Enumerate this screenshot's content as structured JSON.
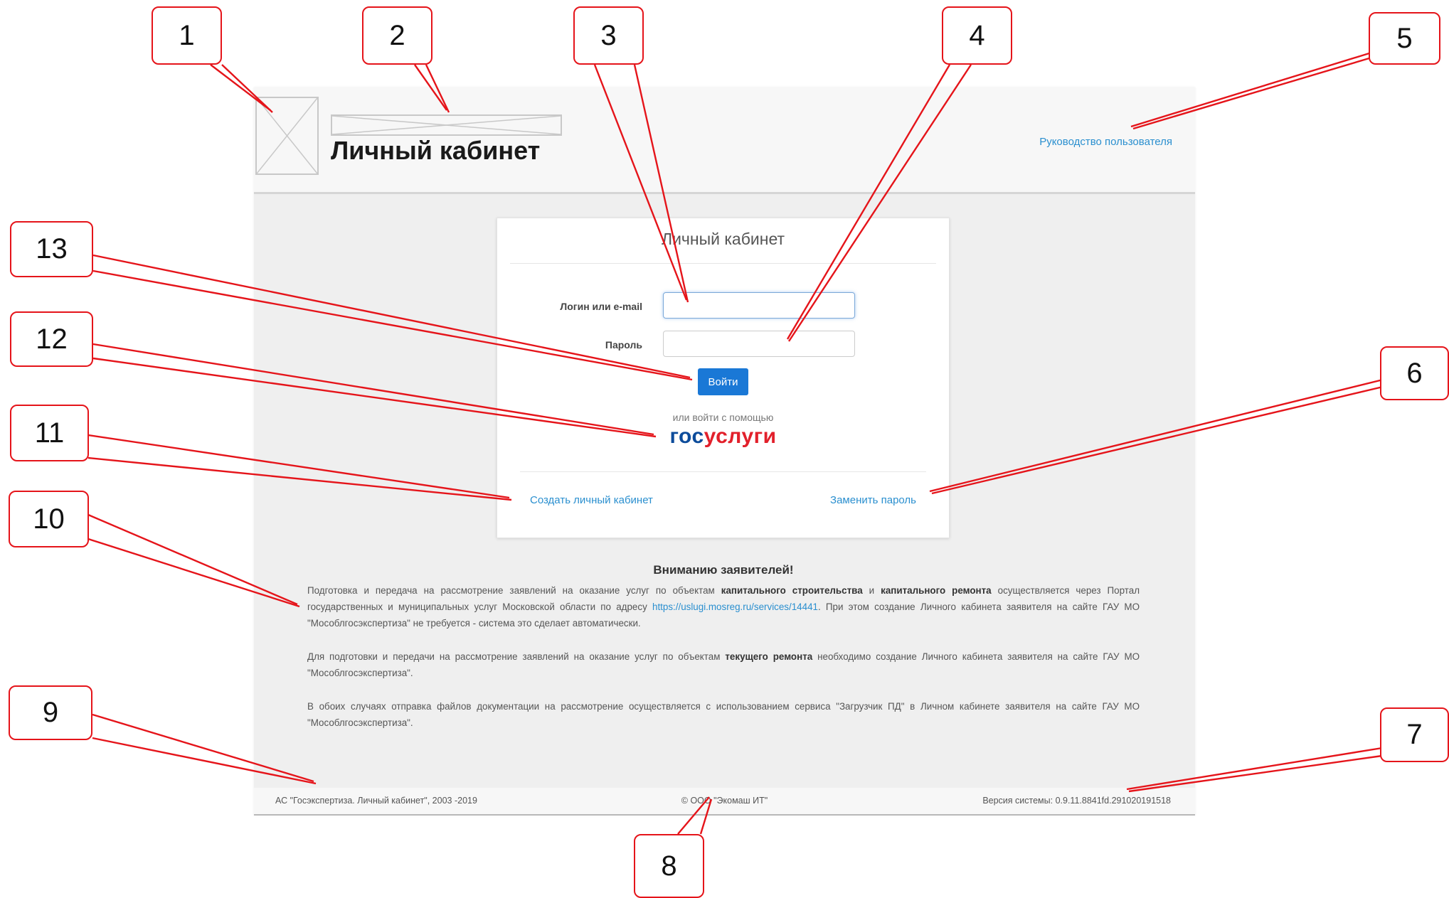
{
  "header": {
    "site_title": "Личный кабинет",
    "manual_link": "Руководство пользователя"
  },
  "login_card": {
    "title": "Личный кабинет",
    "login_label": "Логин или e-mail",
    "login_value": "",
    "password_label": "Пароль",
    "password_value": "",
    "login_button": "Войти",
    "alt_login_text": "или войти с помощью",
    "gosuslugi_part1": "гос",
    "gosuslugi_part2": "услуги",
    "create_account_link": "Создать личный кабинет",
    "change_password_link": "Заменить пароль"
  },
  "notice": {
    "title": "Вниманию заявителей!",
    "p1_text1": "Подготовка и передача на рассмотрение заявлений на оказание услуг по объектам ",
    "p1_bold1": "капитального строительства",
    "p1_text2": " и ",
    "p1_bold2": "капитального ремонта",
    "p1_text3": " осуществляется через Портал государственных и муниципальных услуг Московской области по адресу ",
    "p1_link": "https://uslugi.mosreg.ru/services/14441",
    "p1_text4": ". При этом создание Личного кабинета заявителя на сайте ГАУ МО \"Мособлгосэкспертиза\" не требуется - система это сделает автоматически.",
    "p2_text1": "Для подготовки и передачи на рассмотрение заявлений на оказание услуг по объектам ",
    "p2_bold1": "текущего ремонта",
    "p2_text2": " необходимо создание Личного кабинета заявителя на сайте ГАУ МО \"Мособлгосэкспертиза\".",
    "p3_text": "В обоих случаях отправка файлов документации на рассмотрение осуществляется с использованием сервиса \"Загрузчик ПД\" в Личном кабинете заявителя на сайте ГАУ МО \"Мособлгосэкспертиза\"."
  },
  "footer": {
    "copyright": "АС \"Госэкспертиза. Личный кабинет\", 2003 -2019",
    "company": "© ООО \"Экомаш ИТ\"",
    "version": "Версия системы: 0.9.11.8841fd.291020191518"
  },
  "callouts": [
    "1",
    "2",
    "3",
    "4",
    "5",
    "6",
    "7",
    "8",
    "9",
    "10",
    "11",
    "12",
    "13"
  ],
  "colors": {
    "callout_border": "#e5141a",
    "link": "#2a8fcf",
    "button": "#1a78d6",
    "gosuslugi_blue": "#0d4c9b",
    "gosuslugi_red": "#e2202b"
  }
}
